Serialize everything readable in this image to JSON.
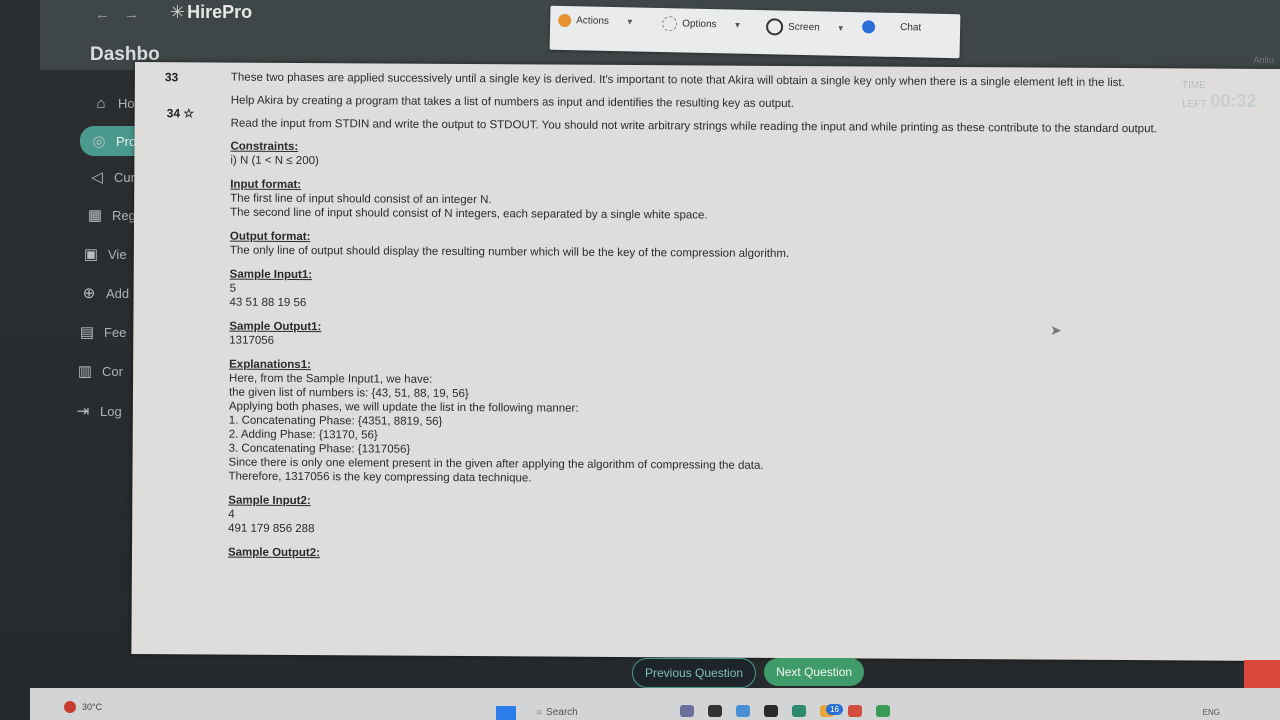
{
  "browser": {
    "back_icon": "←",
    "forward_icon": "→"
  },
  "brand": {
    "name": "HirePro",
    "star": "✳"
  },
  "toolbar": {
    "actions_label": "Actions",
    "options_label": "Options",
    "screen_label": "Screen",
    "chat_label": "Chat"
  },
  "dashboard_title": "Dashbo",
  "user_name": "Anitu",
  "timer": {
    "label": "TIME LEFT",
    "value": "00:32"
  },
  "sidebar": {
    "items": [
      {
        "label": "Hor",
        "icon": "home-icon",
        "glyph": "⌂"
      },
      {
        "label": "Pro",
        "icon": "user-circle-icon",
        "glyph": "◎"
      },
      {
        "label": "Cur",
        "icon": "speaker-icon",
        "glyph": "◁"
      },
      {
        "label": "Reg",
        "icon": "building-icon",
        "glyph": "▦"
      },
      {
        "label": "Vie",
        "icon": "inbox-icon",
        "glyph": "▣"
      },
      {
        "label": "Add",
        "icon": "plus-circle-icon",
        "glyph": "⊕"
      },
      {
        "label": "Fee",
        "icon": "document-icon",
        "glyph": "▤"
      },
      {
        "label": "Cor",
        "icon": "clipboard-icon",
        "glyph": "▥"
      },
      {
        "label": "Log",
        "icon": "logout-icon",
        "glyph": "⇥"
      }
    ]
  },
  "questions": {
    "q33": "33",
    "q34": "34",
    "star": "☆"
  },
  "problem": {
    "para1": "These two phases are applied successively until a single key is derived. It's important to note that Akira will obtain a single key only when there is a single element left in the list.",
    "para2": "Help Akira by creating a program that takes a list of numbers as input and identifies the resulting key as output.",
    "para3": "Read the input from STDIN and write the output to STDOUT. You should not write arbitrary strings while reading the input and while printing as these contribute to the standard output.",
    "constraints_heading": "Constraints:",
    "constraints_line": "i) N (1 < N ≤ 200)",
    "input_format_heading": "Input format:",
    "input_format_line1": "The first line of input should consist of an integer N.",
    "input_format_line2": "The second line of input should consist of N integers, each separated by a single white space.",
    "output_format_heading": "Output format:",
    "output_format_line": "The only line of output should display the resulting number which will be the key of the compression algorithm.",
    "sample_input1_heading": "Sample Input1:",
    "sample_input1_line1": "5",
    "sample_input1_line2": "43 51 88 19 56",
    "sample_output1_heading": "Sample Output1:",
    "sample_output1_line": "1317056",
    "explanations1_heading": "Explanations1:",
    "explanations1_lines": [
      "Here, from the Sample Input1, we have:",
      "the given list of numbers is: {43, 51, 88, 19, 56}",
      "Applying both phases, we will update the list in the following manner:",
      "1. Concatenating Phase: {4351, 8819, 56}",
      "2. Adding Phase: {13170, 56}",
      "3. Concatenating Phase: {1317056}",
      "Since there is only one element present in the given after applying the algorithm of compressing the data.",
      "Therefore, 1317056 is the key compressing data technique."
    ],
    "sample_input2_heading": "Sample Input2:",
    "sample_input2_line1": "4",
    "sample_input2_line2": "491 179 856 288",
    "sample_output2_heading": "Sample Output2:"
  },
  "footer": {
    "prev_label": "Previous Question",
    "next_label": "Next Question"
  },
  "taskbar": {
    "weather": "30°C",
    "search_placeholder": "Search",
    "badge": "16",
    "lang": "ENG"
  },
  "colors": {
    "accent": "#4a9a8e",
    "next_button": "#3f9b6a",
    "alert": "#d9483b"
  }
}
